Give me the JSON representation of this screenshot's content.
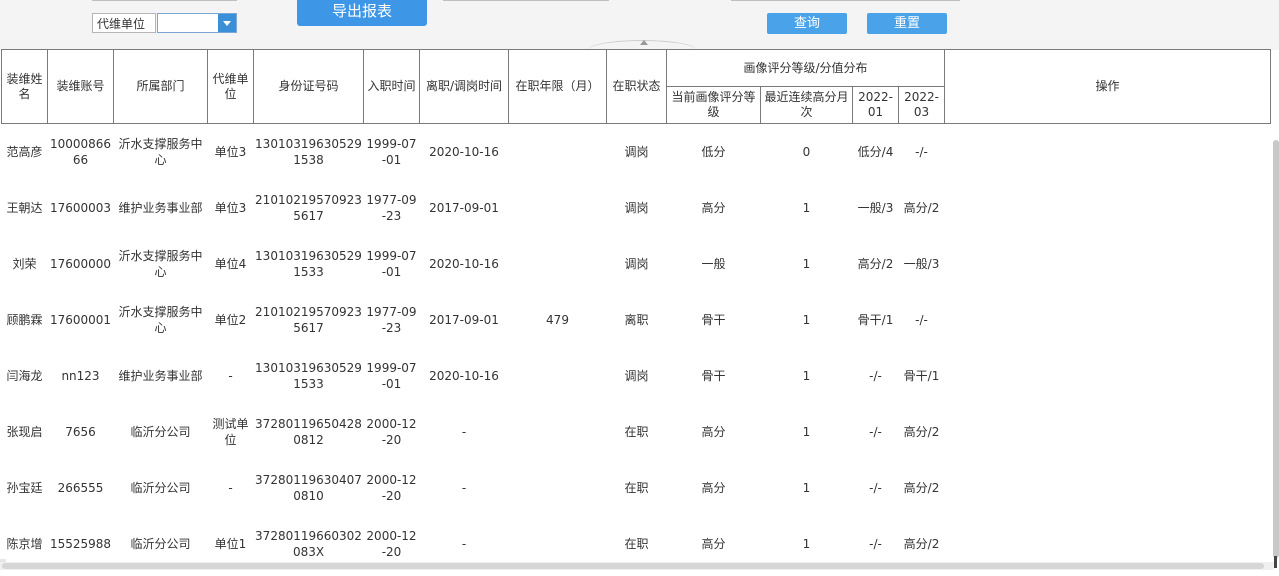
{
  "toolbar": {
    "unit_label": "代维单位",
    "unit_value": "",
    "export_label": "导出报表",
    "query_label": "查询",
    "reset_label": "重置"
  },
  "headers": {
    "name": "装维姓名",
    "account": "装维账号",
    "dept": "所属部门",
    "unit": "代维单位",
    "id": "身份证号码",
    "join": "入职时间",
    "leave": "离职/调岗时间",
    "tenure": "在职年限（月）",
    "status": "在职状态",
    "group": "画像评分等级/分值分布",
    "current": "当前画像评分等级",
    "recent": "最近连续高分月次",
    "m1": "2022-01",
    "m2": "2022-03",
    "ops": "操作"
  },
  "rows": [
    {
      "name": "范高彦",
      "account": "1000086666",
      "dept": "沂水支撑服务中心",
      "unit": "单位3",
      "id": "130103196305291538",
      "join": "1999-07-01",
      "leave": "2020-10-16",
      "tenure": "",
      "status": "调岗",
      "current": "低分",
      "recent": "0",
      "m1": "低分/4",
      "m2": "-/-"
    },
    {
      "name": "王朝达",
      "account": "17600003",
      "dept": "维护业务事业部",
      "unit": "单位3",
      "id": "210102195709235617",
      "join": "1977-09-23",
      "leave": "2017-09-01",
      "tenure": "",
      "status": "调岗",
      "current": "高分",
      "recent": "1",
      "m1": "一般/3",
      "m2": "高分/2"
    },
    {
      "name": "刘荣",
      "account": "17600000",
      "dept": "沂水支撑服务中心",
      "unit": "单位4",
      "id": "130103196305291533",
      "join": "1999-07-01",
      "leave": "2020-10-16",
      "tenure": "",
      "status": "调岗",
      "current": "一般",
      "recent": "1",
      "m1": "高分/2",
      "m2": "一般/3"
    },
    {
      "name": "顾鹏霖",
      "account": "17600001",
      "dept": "沂水支撑服务中心",
      "unit": "单位2",
      "id": "210102195709235617",
      "join": "1977-09-23",
      "leave": "2017-09-01",
      "tenure": "479",
      "status": "离职",
      "current": "骨干",
      "recent": "1",
      "m1": "骨干/1",
      "m2": "-/-"
    },
    {
      "name": "闫海龙",
      "account": "nn123",
      "dept": "维护业务事业部",
      "unit": "-",
      "id": "130103196305291533",
      "join": "1999-07-01",
      "leave": "2020-10-16",
      "tenure": "",
      "status": "调岗",
      "current": "骨干",
      "recent": "1",
      "m1": "-/-",
      "m2": "骨干/1"
    },
    {
      "name": "张现启",
      "account": "7656",
      "dept": "临沂分公司",
      "unit": "测试单位",
      "id": "372801196504280812",
      "join": "2000-12-20",
      "leave": "-",
      "tenure": "",
      "status": "在职",
      "current": "高分",
      "recent": "1",
      "m1": "-/-",
      "m2": "高分/2"
    },
    {
      "name": "孙宝廷",
      "account": "266555",
      "dept": "临沂分公司",
      "unit": "-",
      "id": "372801196304070810",
      "join": "2000-12-20",
      "leave": "-",
      "tenure": "",
      "status": "在职",
      "current": "高分",
      "recent": "1",
      "m1": "-/-",
      "m2": "高分/2"
    },
    {
      "name": "陈京增",
      "account": "15525988",
      "dept": "临沂分公司",
      "unit": "单位1",
      "id": "37280119660302083X",
      "join": "2000-12-20",
      "leave": "-",
      "tenure": "",
      "status": "在职",
      "current": "高分",
      "recent": "1",
      "m1": "-/-",
      "m2": "高分/2"
    }
  ]
}
